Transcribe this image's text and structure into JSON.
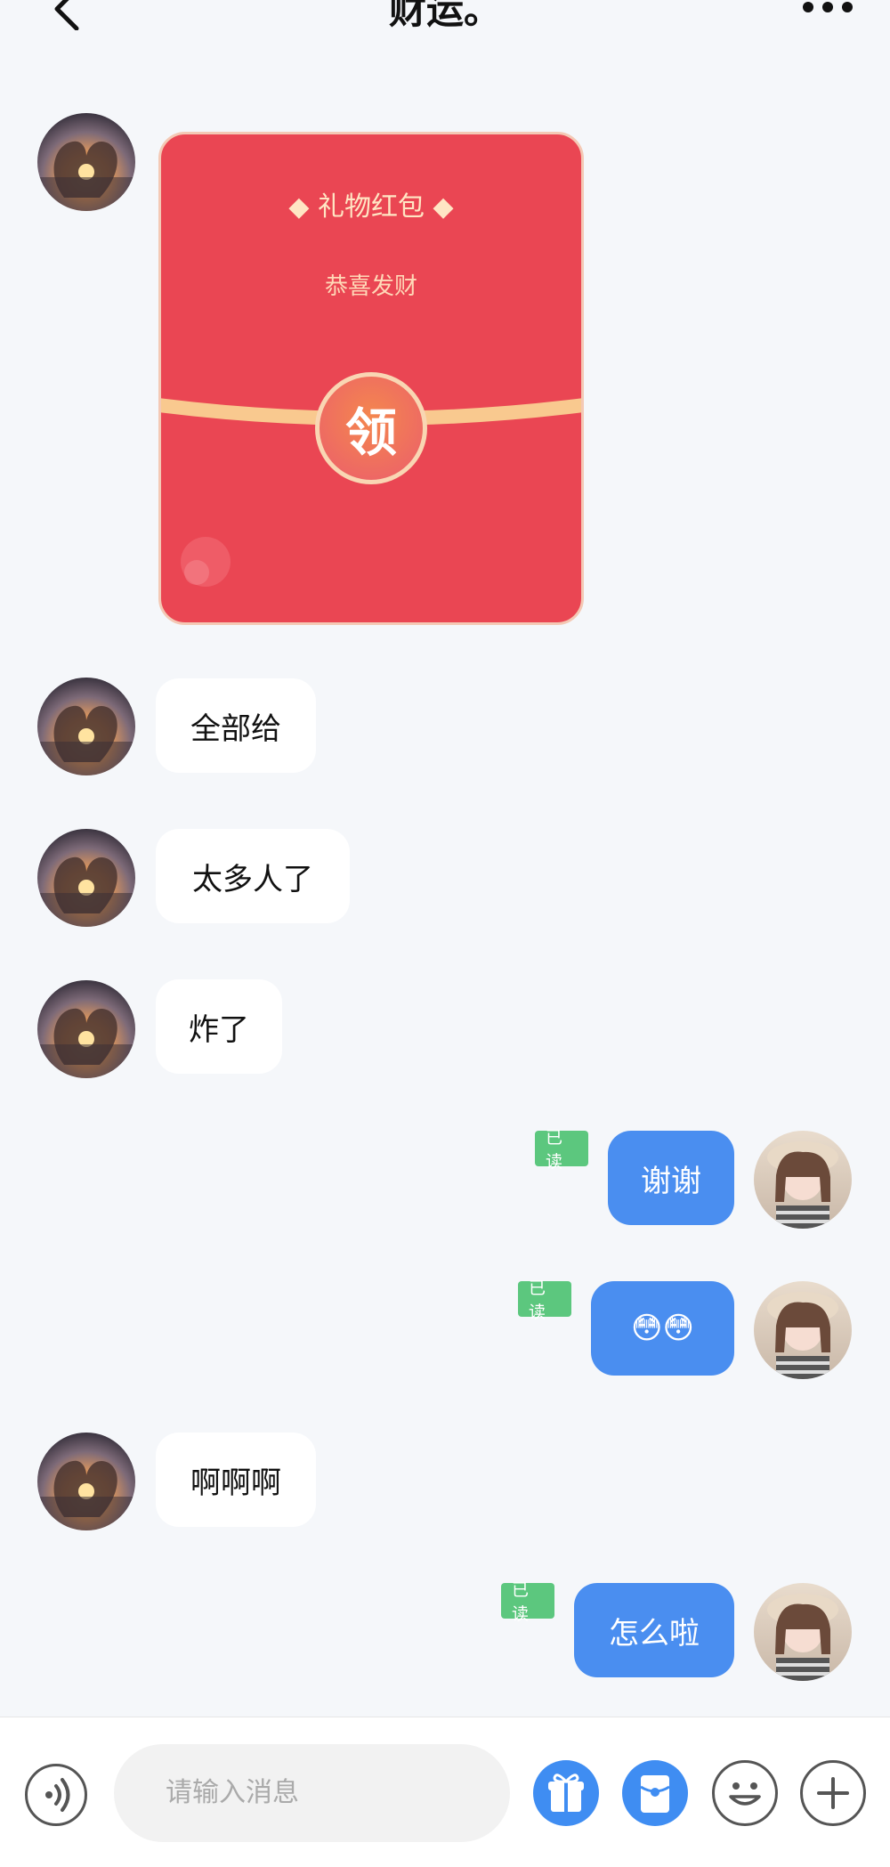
{
  "header": {
    "title": "财运。"
  },
  "red_packet": {
    "title": "◆ 礼物红包 ◆",
    "subtitle": "恭喜发财",
    "button_label": "领"
  },
  "messages": [
    {
      "side": "left",
      "text": "全部给"
    },
    {
      "side": "left",
      "text": "太多人了"
    },
    {
      "side": "left",
      "text": "炸了"
    },
    {
      "side": "right",
      "text": "谢谢",
      "status": "已读"
    },
    {
      "side": "right",
      "text": "😳😳",
      "status": "已读"
    },
    {
      "side": "left",
      "text": "啊啊啊"
    },
    {
      "side": "right",
      "text": "怎么啦",
      "status": "已读"
    }
  ],
  "composer": {
    "placeholder": "请输入消息"
  },
  "colors": {
    "sent_bubble": "#4a8ef0",
    "received_bubble": "#ffffff",
    "read_badge": "#5cc77e",
    "red_packet": "#ea4653"
  }
}
